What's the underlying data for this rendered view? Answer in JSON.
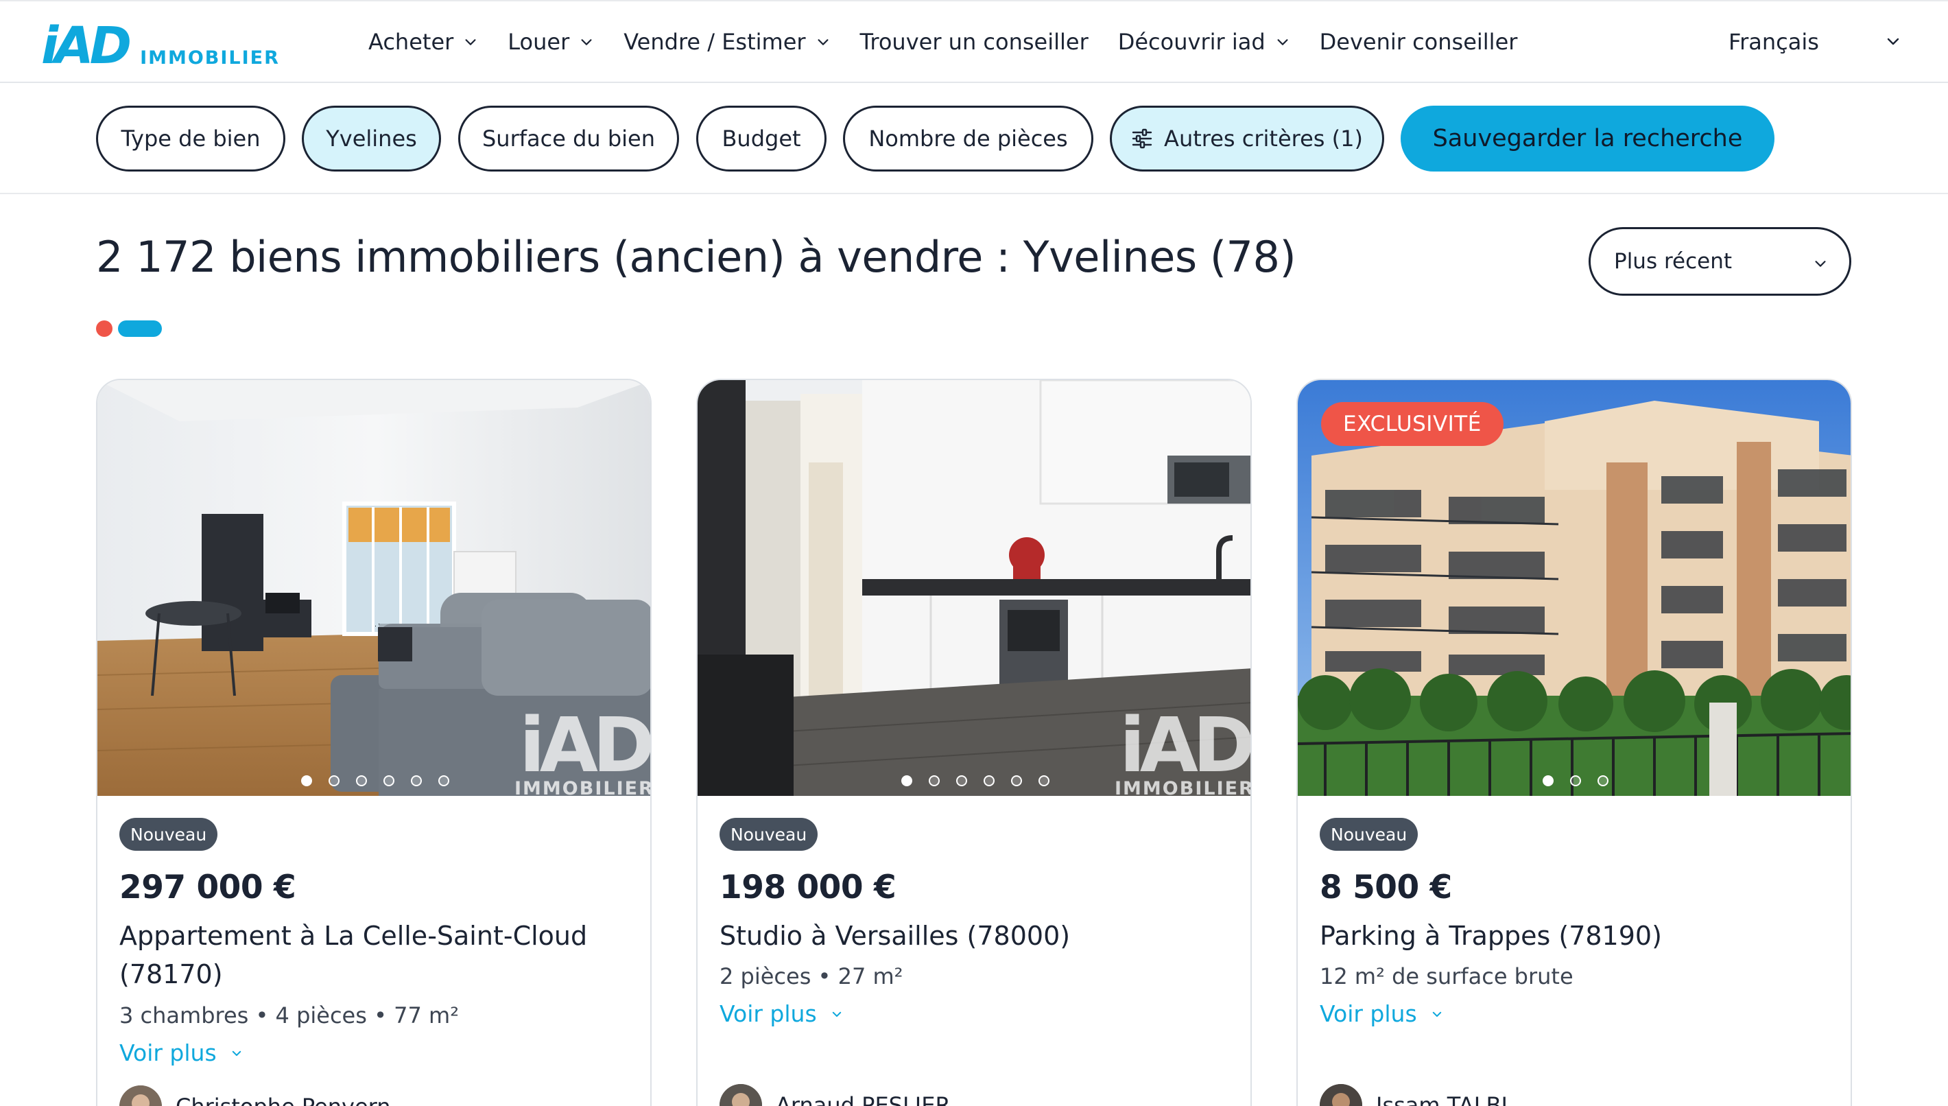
{
  "header": {
    "logo_mark": "iAD",
    "logo_sub": "IMMOBILIER",
    "nav": [
      {
        "label": "Acheter",
        "has_dropdown": true
      },
      {
        "label": "Louer",
        "has_dropdown": true
      },
      {
        "label": "Vendre / Estimer",
        "has_dropdown": true
      },
      {
        "label": "Trouver un conseiller",
        "has_dropdown": false
      },
      {
        "label": "Découvrir iad",
        "has_dropdown": true
      },
      {
        "label": "Devenir conseiller",
        "has_dropdown": false
      }
    ],
    "language": "Français"
  },
  "filters": {
    "chips": [
      {
        "label": "Type de bien",
        "active": false
      },
      {
        "label": "Yvelines",
        "active": true
      },
      {
        "label": "Surface du bien",
        "active": false
      },
      {
        "label": "Budget",
        "active": false
      },
      {
        "label": "Nombre de pièces",
        "active": false
      },
      {
        "label": "Autres critères (1)",
        "active": true,
        "icon": "sliders-icon"
      }
    ],
    "save_label": "Sauvegarder la recherche"
  },
  "results": {
    "title": "2 172 biens immobiliers (ancien) à vendre : Yvelines (78)",
    "sort_value": "Plus récent"
  },
  "listings": [
    {
      "badge": "Nouveau",
      "exclusive": null,
      "price": "297 000 €",
      "title": "Appartement à La Celle-Saint-Cloud (78170)",
      "details": "3 chambres • 4 pièces • 77 m²",
      "more": "Voir plus",
      "agent": "Christophe Penvern",
      "photo_count": 6,
      "photo_active": 0,
      "watermark_mark": "iAD",
      "watermark_sub": "IMMOBILIER"
    },
    {
      "badge": "Nouveau",
      "exclusive": null,
      "price": "198 000 €",
      "title": "Studio à Versailles (78000)",
      "details": "2 pièces • 27 m²",
      "more": "Voir plus",
      "agent": "Arnaud PESLIER",
      "photo_count": 6,
      "photo_active": 0,
      "watermark_mark": "iAD",
      "watermark_sub": "IMMOBILIER"
    },
    {
      "badge": "Nouveau",
      "exclusive": "EXCLUSIVITÉ",
      "price": "8 500 €",
      "title": "Parking à Trappes (78190)",
      "details": "12 m² de surface brute",
      "more": "Voir plus",
      "agent": "Issam TALBI",
      "photo_count": 3,
      "photo_active": 0
    }
  ],
  "colors": {
    "brand_blue": "#0fa8dd",
    "accent_red": "#ef5548",
    "chip_active_bg": "#d6f3fb",
    "text_dark": "#1b2333",
    "badge_bg": "#46505d"
  }
}
